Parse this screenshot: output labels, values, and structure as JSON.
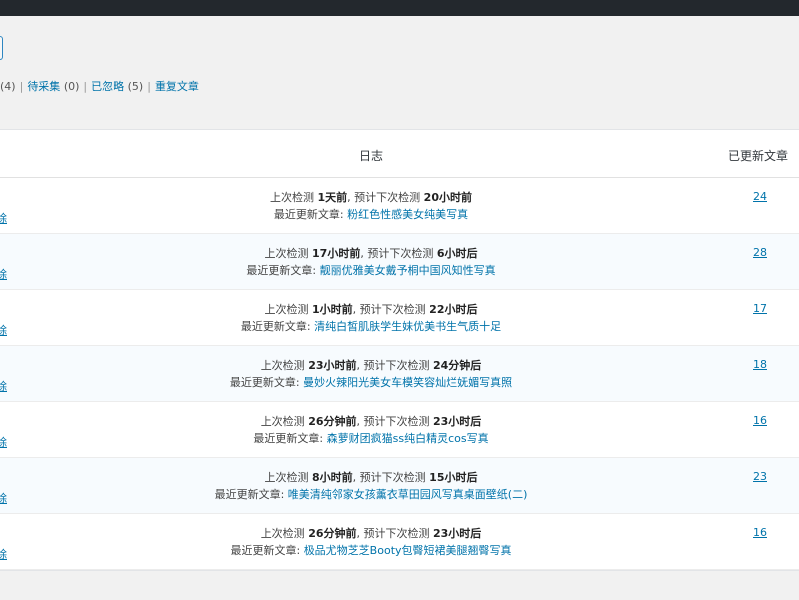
{
  "filters": {
    "first_count": "(4)",
    "pending_label": "待采集",
    "pending_count": "(0)",
    "ignored_label": "已忽略",
    "ignored_count": "(5)",
    "duplicate_label": "重复文章",
    "separator": "|"
  },
  "table": {
    "col_log": "日志",
    "col_updated": "已更新文章",
    "row_action_label": "除",
    "labels": {
      "last_check": "上次检测",
      "next_check": ", 预计下次检测",
      "latest": "最近更新文章: "
    },
    "rows": [
      {
        "last": "1天前",
        "next": "20小时前",
        "article": "粉红色性感美女纯美写真",
        "count": "24"
      },
      {
        "last": "17小时前",
        "next": "6小时后",
        "article": "靓丽优雅美女戴予桐中国风知性写真",
        "count": "28"
      },
      {
        "last": "1小时前",
        "next": "22小时后",
        "article": "清纯白皙肌肤学生妹优美书生气质十足",
        "count": "17"
      },
      {
        "last": "23小时前",
        "next": "24分钟后",
        "article": "曼妙火辣阳光美女车模笑容灿烂妩媚写真照",
        "count": "18"
      },
      {
        "last": "26分钟前",
        "next": "23小时后",
        "article": "森萝财团疯猫ss纯白精灵cos写真",
        "count": "16"
      },
      {
        "last": "8小时前",
        "next": "15小时后",
        "article": "唯美清纯邻家女孩薰衣草田园风写真桌面壁纸(二)",
        "count": "23"
      },
      {
        "last": "26分钟前",
        "next": "23小时后",
        "article": "极品尤物芝芝Booty包臀短裙美腿翘臀写真",
        "count": "16"
      }
    ]
  }
}
